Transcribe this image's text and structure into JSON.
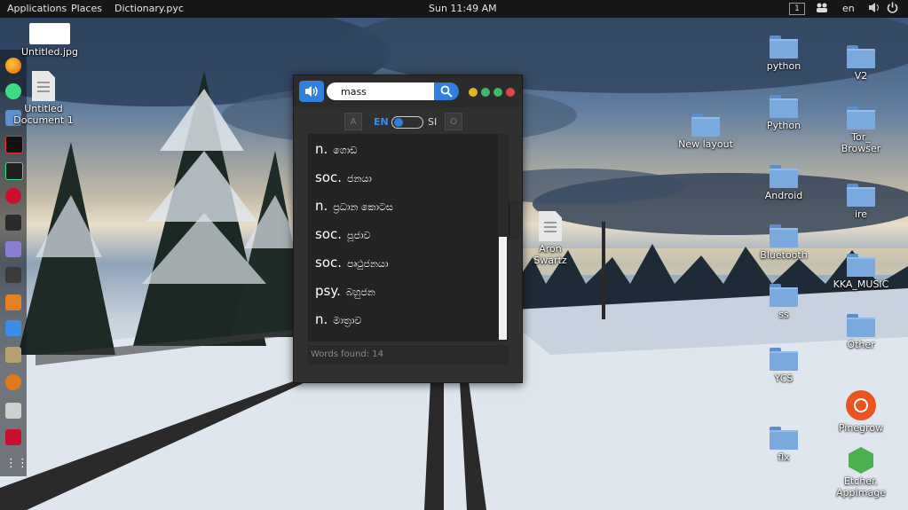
{
  "topbar": {
    "applications": "Applications",
    "places": "Places",
    "active_app": "Dictionary.pyc",
    "clock": "Sun 11:49 AM",
    "workspace": "1",
    "language": "en",
    "icons": [
      "workspace-indicator-icon",
      "people-icon",
      "volume-icon",
      "power-icon"
    ]
  },
  "dock": {
    "icons": [
      "firefox-icon",
      "android-studio-icon",
      "files-icon",
      "intellij-icon",
      "pycharm-icon",
      "ruby-icon",
      "terminal-icon",
      "text-editor-icon",
      "dev-tools-icon",
      "calculator-icon",
      "package-icon",
      "archive-icon",
      "java-icon",
      "database-icon",
      "ruby-mine-icon",
      "app-grid-icon"
    ]
  },
  "desktop": {
    "untitled_jpg": "Untitled.jpg",
    "untitled_doc_line1": "Untitled",
    "untitled_doc_line2": "Document 1",
    "new_layout": "New layout",
    "aron_swartz_line1": "Aron",
    "aron_swartz_line2": "Swartz",
    "python_lower": "python",
    "python_upper": "Python",
    "android": "Android",
    "bluetooth": "Bluetooth",
    "ss": "ss",
    "ycs": "YCS",
    "flx": "flx",
    "v2": "V2",
    "tor_line1": "Tor_",
    "tor_line2": "Browser",
    "ire": "ire",
    "kka_music": "KKA_MUSIC",
    "other": "Other",
    "pinegrow": "Pinegrow",
    "etcher_line1": "Etcher.",
    "etcher_line2": "AppImage"
  },
  "dictionary": {
    "search_value": "mass",
    "btn_a": "A",
    "btn_o": "O",
    "lang_en": "EN",
    "lang_si": "SI",
    "results": [
      {
        "pos": "n.",
        "word": "ගොඩ"
      },
      {
        "pos": "soc.",
        "word": "ජනයා"
      },
      {
        "pos": "n.",
        "word": "ප්‍රධාන කොටස"
      },
      {
        "pos": "soc.",
        "word": "පූජාව"
      },
      {
        "pos": "soc.",
        "word": "පෘථුජනයා"
      },
      {
        "pos": "psy.",
        "word": "බහුජන"
      },
      {
        "pos": "n.",
        "word": "මාත්‍රාව"
      }
    ],
    "status": "Words found: 14",
    "colors": {
      "accent": "#2f7fdc",
      "minimize": "#e0b526",
      "restore": "#3fb86b",
      "maximize": "#3fb86b",
      "close": "#e0454a"
    }
  }
}
